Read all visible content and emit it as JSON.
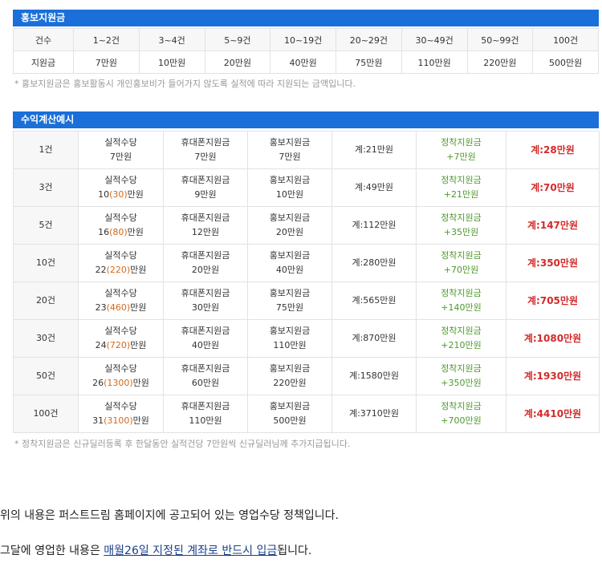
{
  "promo": {
    "title": "홍보지원금",
    "row_labels": [
      "건수",
      "지원금"
    ],
    "counts": [
      "1~2건",
      "3~4건",
      "5~9건",
      "10~19건",
      "20~29건",
      "30~49건",
      "50~99건",
      "100건"
    ],
    "amounts": [
      "7만원",
      "10만원",
      "20만원",
      "40만원",
      "75만원",
      "110만원",
      "220만원",
      "500만원"
    ],
    "note": "* 홍보지원금은 홍보활동시 개인홍보비가 들어가지 않도록 실적에 따라 지원되는 금액입니다."
  },
  "calc": {
    "title": "수익계산예시",
    "labels": {
      "perf": "실적수당",
      "phone": "휴대폰지원금",
      "promo": "홍보지원금",
      "settle": "정착지원금"
    },
    "rows": [
      {
        "count": "1건",
        "perf_a": "7만원",
        "perf_b": "",
        "perf_c": "",
        "phone": "7만원",
        "promo": "7만원",
        "subtotal": "계:21만원",
        "settle": "+7만원",
        "total": "계:28만원"
      },
      {
        "count": "3건",
        "perf_a": "10",
        "perf_b": "(30)",
        "perf_c": "만원",
        "phone": "9만원",
        "promo": "10만원",
        "subtotal": "계:49만원",
        "settle": "+21만원",
        "total": "계:70만원"
      },
      {
        "count": "5건",
        "perf_a": "16",
        "perf_b": "(80)",
        "perf_c": "만원",
        "phone": "12만원",
        "promo": "20만원",
        "subtotal": "계:112만원",
        "settle": "+35만원",
        "total": "계:147만원"
      },
      {
        "count": "10건",
        "perf_a": "22",
        "perf_b": "(220)",
        "perf_c": "만원",
        "phone": "20만원",
        "promo": "40만원",
        "subtotal": "계:280만원",
        "settle": "+70만원",
        "total": "계:350만원"
      },
      {
        "count": "20건",
        "perf_a": "23",
        "perf_b": "(460)",
        "perf_c": "만원",
        "phone": "30만원",
        "promo": "75만원",
        "subtotal": "계:565만원",
        "settle": "+140만원",
        "total": "계:705만원"
      },
      {
        "count": "30건",
        "perf_a": "24",
        "perf_b": "(720)",
        "perf_c": "만원",
        "phone": "40만원",
        "promo": "110만원",
        "subtotal": "계:870만원",
        "settle": "+210만원",
        "total": "계:1080만원"
      },
      {
        "count": "50건",
        "perf_a": "26",
        "perf_b": "(1300)",
        "perf_c": "만원",
        "phone": "60만원",
        "promo": "220만원",
        "subtotal": "계:1580만원",
        "settle": "+350만원",
        "total": "계:1930만원"
      },
      {
        "count": "100건",
        "perf_a": "31",
        "perf_b": "(3100)",
        "perf_c": "만원",
        "phone": "110만원",
        "promo": "500만원",
        "subtotal": "계:3710만원",
        "settle": "+700만원",
        "total": "계:4410만원"
      }
    ],
    "note": "* 정착지원금은 신규딜러등록 후 한달동안 실적건당 7만원씩 신규딜러님께 추가지급됩니다."
  },
  "body": {
    "line1": "위의 내용은 퍼스트드림 홈페이지에 공고되어 있는 영업수당 정책입니다.",
    "line2_pre": "그달에 영업한 내용은 ",
    "line2_link": "매월26일 지정된 계좌로 반드시 입금",
    "line2_post": "됩니다."
  }
}
